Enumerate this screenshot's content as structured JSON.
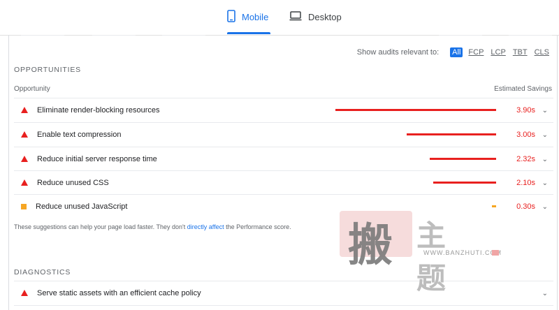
{
  "tabs": [
    {
      "label": "Mobile",
      "icon": "mobile-phone-icon",
      "active": true
    },
    {
      "label": "Desktop",
      "icon": "laptop-icon",
      "active": false
    }
  ],
  "filters": {
    "label": "Show audits relevant to:",
    "options": [
      "All",
      "FCP",
      "LCP",
      "TBT",
      "CLS"
    ],
    "active": "All"
  },
  "opportunities": {
    "title": "OPPORTUNITIES",
    "col_left": "Opportunity",
    "col_right": "Estimated Savings",
    "items": [
      {
        "label": "Eliminate render-blocking resources",
        "savings": "3.90s",
        "severity": "fail"
      },
      {
        "label": "Enable text compression",
        "savings": "3.00s",
        "severity": "fail"
      },
      {
        "label": "Reduce initial server response time",
        "savings": "2.32s",
        "severity": "fail"
      },
      {
        "label": "Reduce unused CSS",
        "savings": "2.10s",
        "severity": "fail"
      },
      {
        "label": "Reduce unused JavaScript",
        "savings": "0.30s",
        "severity": "average"
      }
    ],
    "note_before": "These suggestions can help your page load faster. They don't ",
    "note_link": "directly affect",
    "note_after": " the Performance score."
  },
  "diagnostics": {
    "title": "DIAGNOSTICS",
    "items": [
      {
        "label": "Serve static assets with an efficient cache policy",
        "severity": "fail"
      }
    ]
  },
  "watermark": {
    "big_char": "搬",
    "side_chars": "主题",
    "url": "WWW.BANZHUTI.COM"
  },
  "colors": {
    "accent": "#1a73e8",
    "fail": "#e8201f",
    "average": "#f6a623"
  }
}
